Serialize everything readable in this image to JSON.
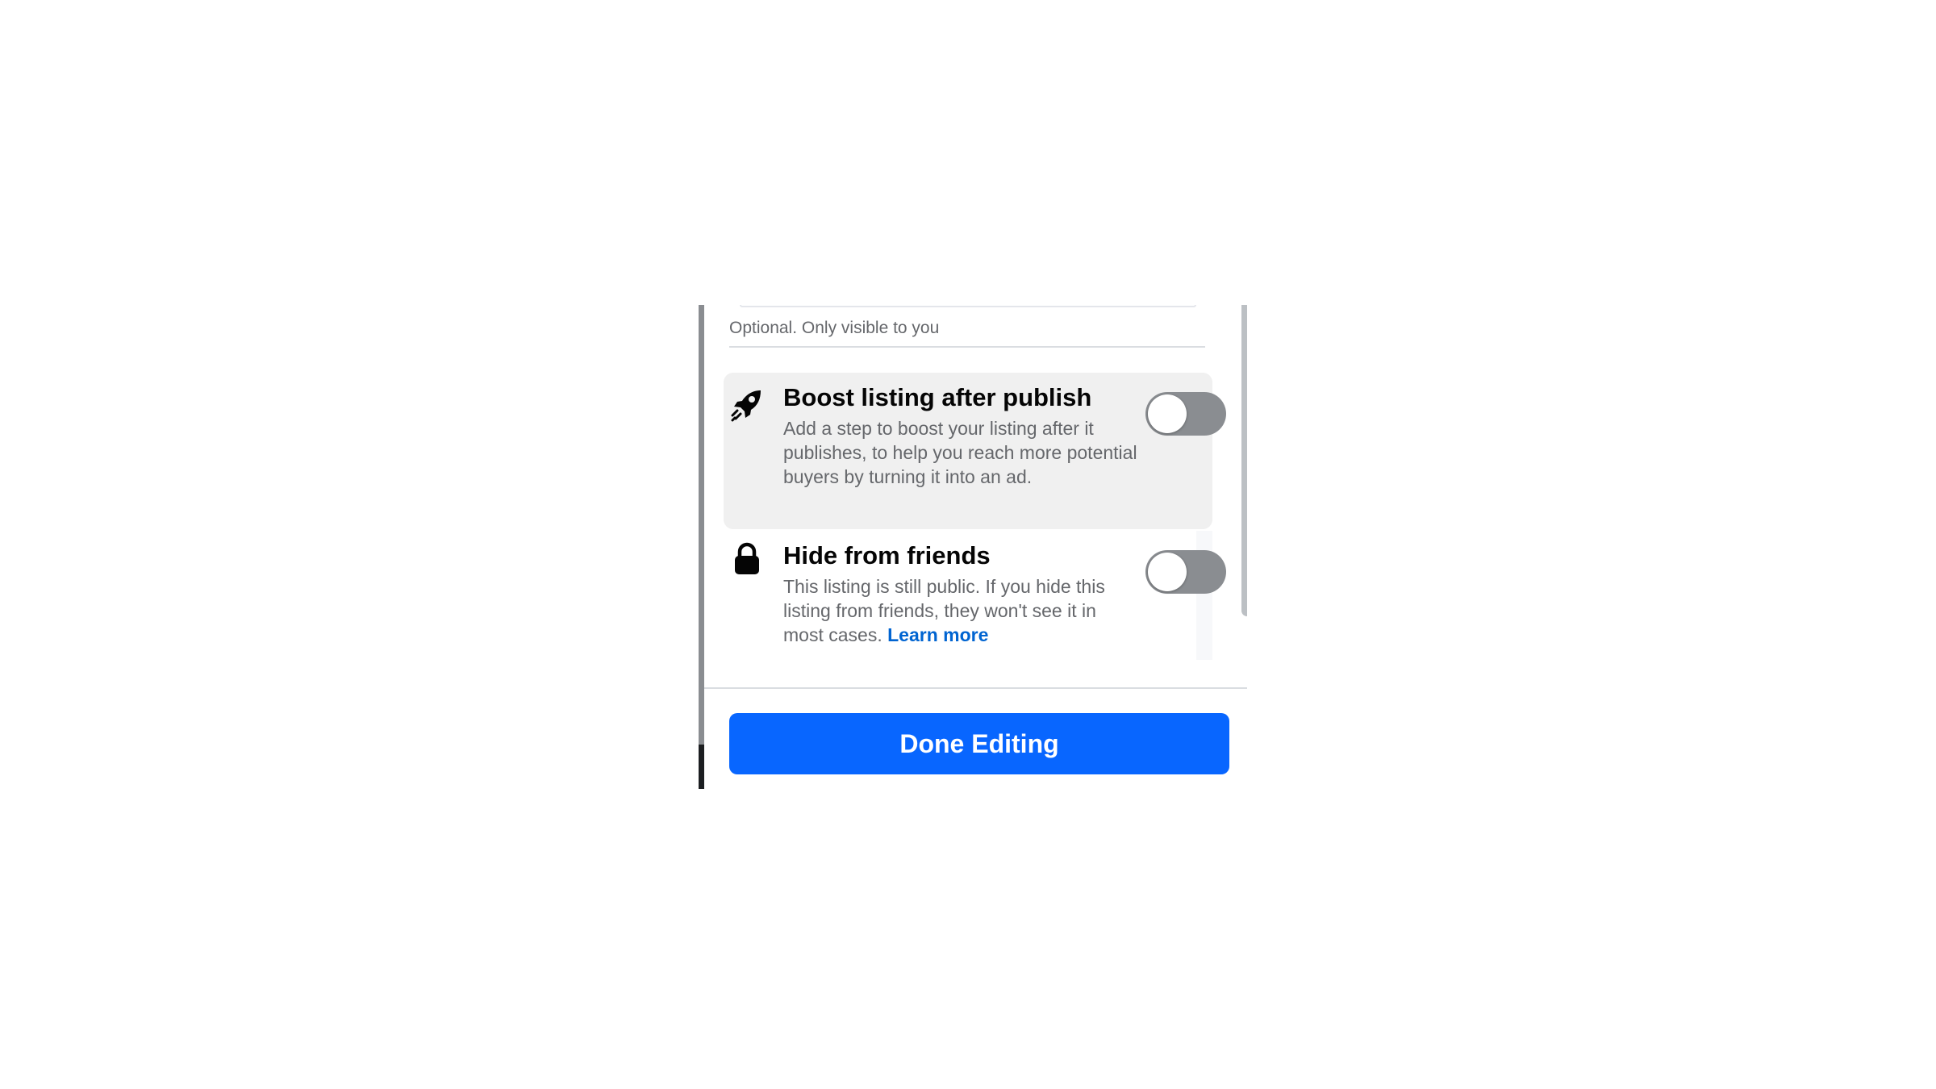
{
  "form": {
    "helper_text": "Optional. Only visible to you"
  },
  "options": {
    "boost": {
      "title": "Boost listing after publish",
      "description": "Add a step to boost your listing after it publishes, to help you reach more potential buyers by turning it into an ad.",
      "enabled": false,
      "icon": "rocket-icon"
    },
    "hide_from_friends": {
      "title": "Hide from friends",
      "description": "This listing is still public. If you hide this listing from friends, they won't see it in most cases.",
      "link_label": "Learn more",
      "enabled": false,
      "icon": "lock-icon"
    }
  },
  "footer": {
    "done_label": "Done Editing"
  },
  "colors": {
    "primary_button": "#0866ff",
    "link": "#0064d1",
    "toggle_off": "#8a8d91",
    "highlight_row": "#f0f0f0"
  }
}
